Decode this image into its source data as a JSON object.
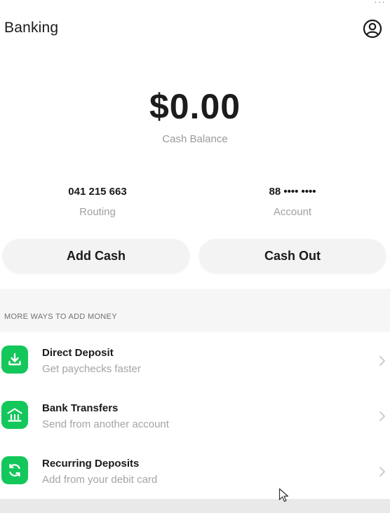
{
  "header": {
    "title": "Banking",
    "profile_icon": "profile-circle-icon"
  },
  "balance": {
    "amount": "$0.00",
    "label": "Cash Balance"
  },
  "routing": {
    "value": "041 215 663",
    "label": "Routing"
  },
  "account": {
    "value": "88 •••• ••••",
    "label": "Account"
  },
  "actions": {
    "add_cash": "Add Cash",
    "cash_out": "Cash Out"
  },
  "more_ways": {
    "heading": "MORE WAYS TO ADD MONEY",
    "items": [
      {
        "title": "Direct Deposit",
        "subtitle": "Get paychecks faster",
        "icon": "download-tray-icon"
      },
      {
        "title": "Bank Transfers",
        "subtitle": "Send from another account",
        "icon": "bank-icon"
      },
      {
        "title": "Recurring Deposits",
        "subtitle": "Add from your debit card",
        "icon": "recurring-arrows-icon"
      }
    ]
  },
  "colors": {
    "accent_green": "#13c75b",
    "muted_text": "#a0a0a0",
    "button_bg": "#f3f3f3"
  }
}
